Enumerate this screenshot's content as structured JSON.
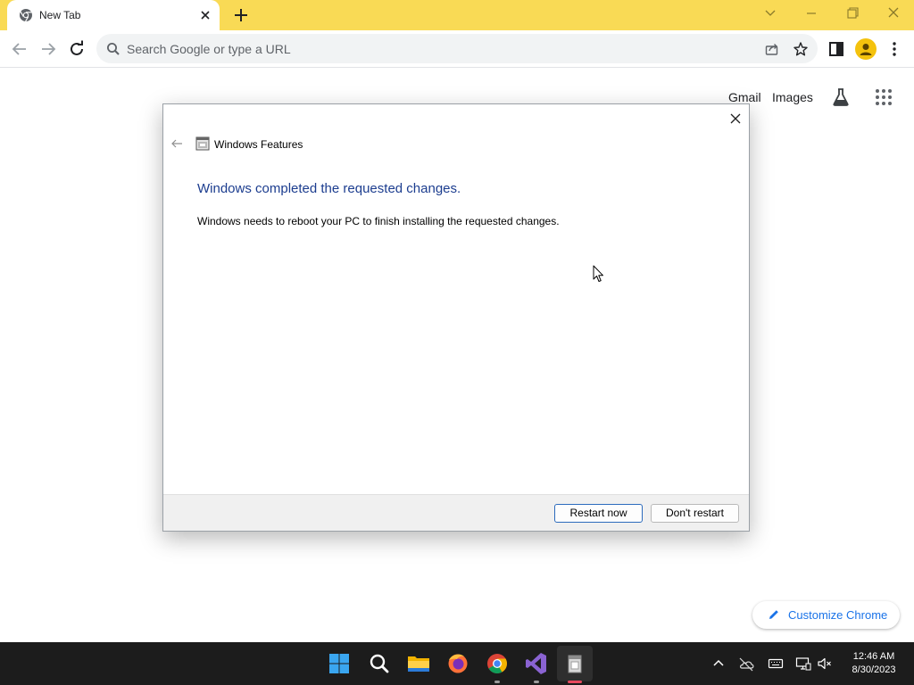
{
  "browser": {
    "tab": {
      "title": "New Tab"
    },
    "omnibox": {
      "placeholder": "Search Google or type a URL"
    }
  },
  "ntp": {
    "links": [
      "Gmail",
      "Images"
    ],
    "customize_label": "Customize Chrome"
  },
  "dialog": {
    "app_name": "Windows Features",
    "heading": "Windows completed the requested changes.",
    "message": "Windows needs to reboot your PC to finish installing the requested changes.",
    "buttons": {
      "restart": "Restart now",
      "dont_restart": "Don't restart"
    }
  },
  "taskbar": {
    "apps": [
      "start-icon",
      "search-icon",
      "file-explorer-icon",
      "firefox-icon",
      "chrome-icon",
      "visual-studio-icon",
      "windows-features-icon"
    ],
    "tray_icons": [
      "chevron-up-icon",
      "onedrive-icon",
      "keyboard-icon",
      "network-icon",
      "volume-muted-icon"
    ],
    "time": "12:46 AM",
    "date": "8/30/2023"
  },
  "colors": {
    "frame": "#f9da55",
    "dialog_heading": "#1c3d8f",
    "link_blue": "#1a73e8",
    "taskbar": "#1c1c1c"
  }
}
